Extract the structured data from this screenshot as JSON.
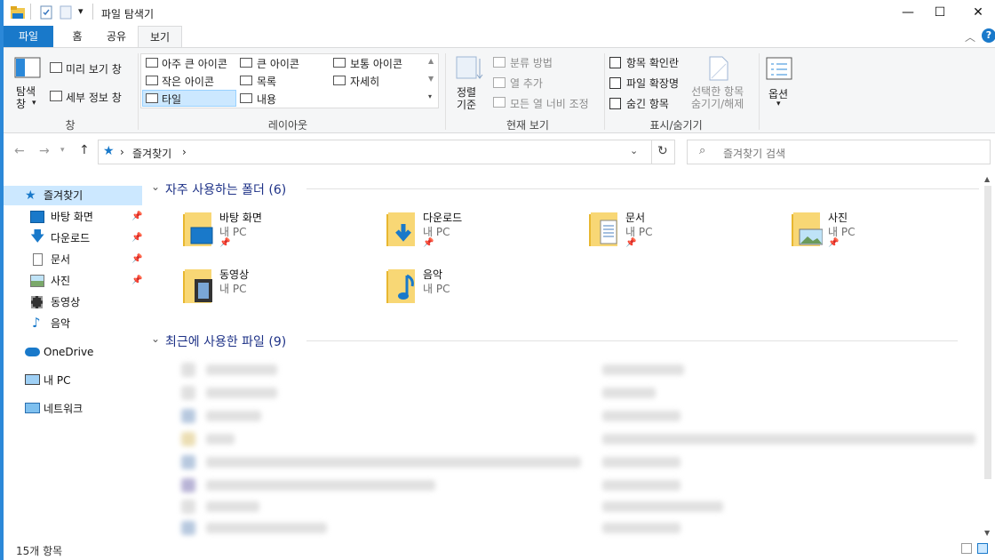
{
  "window": {
    "title": "파일 탐색기",
    "min": "—",
    "max": "☐",
    "close": "✕"
  },
  "qat": {
    "dropdown": "▾"
  },
  "tabs": [
    {
      "label": "파일"
    },
    {
      "label": "홈"
    },
    {
      "label": "공유"
    },
    {
      "label": "보기"
    }
  ],
  "ribbon": {
    "pane_group": {
      "nav_pane": "탐색\n창",
      "preview": "미리 보기 창",
      "details": "세부 정보 창",
      "label": "창"
    },
    "layout": {
      "xlarge": "아주 큰 아이콘",
      "large": "큰 아이콘",
      "medium": "보통 아이콘",
      "small": "작은 아이콘",
      "list": "목록",
      "details": "자세히",
      "tiles": "타일",
      "content": "내용",
      "label": "레이아웃"
    },
    "view": {
      "sort": "정렬\n기준",
      "group": "분류 방법",
      "add_col": "열 추가",
      "fit_col": "모든 열 너비 조정",
      "label": "현재 보기"
    },
    "showhide": {
      "checkboxes": "항목 확인란",
      "extensions": "파일 확장명",
      "hidden": "숨긴 항목",
      "hide_selected": "선택한 항목\n숨기기/해제",
      "label": "표시/숨기기"
    },
    "options": {
      "label": "옵션"
    }
  },
  "address": {
    "crumb": "즐겨찾기",
    "sep": "›",
    "search_placeholder": "즐겨찾기 검색"
  },
  "navpane": {
    "items": [
      {
        "label": "즐겨찾기",
        "pinned": false
      },
      {
        "label": "바탕 화면",
        "pinned": true
      },
      {
        "label": "다운로드",
        "pinned": true
      },
      {
        "label": "문서",
        "pinned": true
      },
      {
        "label": "사진",
        "pinned": true
      },
      {
        "label": "동영상",
        "pinned": false
      },
      {
        "label": "음악",
        "pinned": false
      },
      {
        "label": "OneDrive",
        "pinned": false
      },
      {
        "label": "내 PC",
        "pinned": false
      },
      {
        "label": "네트워크",
        "pinned": false
      }
    ]
  },
  "frequent": {
    "heading": "자주 사용하는 폴더 (6)",
    "folders": [
      {
        "name": "바탕 화면",
        "location": "내 PC",
        "pinned": true
      },
      {
        "name": "다운로드",
        "location": "내 PC",
        "pinned": true
      },
      {
        "name": "문서",
        "location": "내 PC",
        "pinned": true
      },
      {
        "name": "사진",
        "location": "내 PC",
        "pinned": true
      },
      {
        "name": "동영상",
        "location": "내 PC",
        "pinned": false
      },
      {
        "name": "음악",
        "location": "내 PC",
        "pinned": false
      }
    ]
  },
  "recent": {
    "heading": "최근에 사용한 파일 (9)"
  },
  "status": {
    "count": "15개 항목"
  },
  "colors": {
    "accent": "#1979ca",
    "selection": "#cce8ff",
    "heading": "#1e3287",
    "folder": "#f0c850"
  }
}
